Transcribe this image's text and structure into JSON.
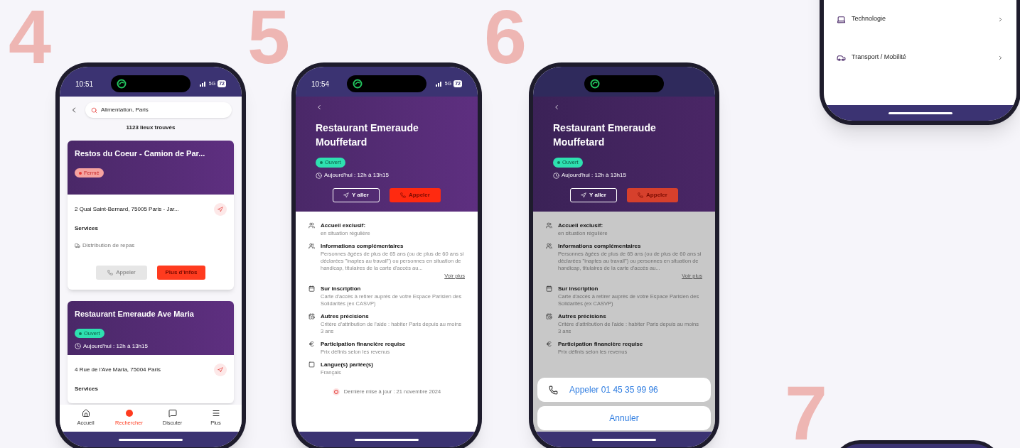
{
  "step_numbers": [
    "4",
    "5",
    "6",
    "7"
  ],
  "screens": [
    {
      "kind": "search_results",
      "status_bar": {
        "time": "10:51",
        "network": "5G",
        "battery": "72"
      },
      "search": {
        "value": "Alimentation, Paris"
      },
      "result_count": "1123 lieux trouvés",
      "cards": [
        {
          "title": "Restos du Coeur - Camion de Par...",
          "badge": {
            "label": "Fermé",
            "open": false
          },
          "address": "2 Quai Saint-Bernard, 75005 Paris - Jar...",
          "services_label": "Services",
          "services": [
            "Distribution de repas"
          ],
          "buttons": [
            "Appeler",
            "Plus d'infos"
          ]
        },
        {
          "title": "Restaurant Emeraude Ave Maria",
          "badge": {
            "label": "Ouvert",
            "open": true
          },
          "hours": "Aujourd'hui : 12h à 13h15",
          "address": "4 Rue de l'Ave Maria, 75004 Paris",
          "services_label": "Services"
        }
      ],
      "tab_bar": [
        {
          "label": "Accueil",
          "selected": false
        },
        {
          "label": "Rechercher",
          "selected": true
        },
        {
          "label": "Discuter",
          "selected": false
        },
        {
          "label": "Plus",
          "selected": false
        }
      ]
    },
    {
      "kind": "place_detail",
      "dimmed": false,
      "status_bar": {
        "time": "10:54",
        "network": "5G",
        "battery": "72"
      },
      "title": "Restaurant Emeraude Mouffetard",
      "badge": {
        "label": "Ouvert",
        "open": true
      },
      "hours": "Aujourd'hui : 12h à 13h15",
      "actions": [
        "Y aller",
        "Appeler"
      ],
      "info": [
        {
          "title": "Accueil exclusif:",
          "text": "en situation régulière"
        },
        {
          "title": "Informations complémentaires",
          "text": "Personnes âgées de plus de 65 ans (ou de plus de 60 ans si déclarées \"inaptes au travail\") ou personnes en situation de handicap, titulaires de la carte d'accès au...",
          "link": "Voir plus"
        },
        {
          "title": "Sur inscription",
          "text": "Carte d'accès à retirer auprès de votre Espace Parisien des Solidarités (ex CASVP)"
        },
        {
          "title": "Autres précisions",
          "text": "Critère d'attribution de l'aide : habiter Paris depuis au moins 3 ans"
        },
        {
          "title": "Participation financière requise",
          "text": "Prix définis selon les revenus"
        },
        {
          "title": "Langue(s) parlée(s)",
          "text": "Français"
        }
      ],
      "last_update": "Dernière mise à jour : 21 novembre 2024"
    },
    {
      "kind": "place_detail",
      "dimmed": true,
      "title": "Restaurant Emeraude Mouffetard",
      "badge": {
        "label": "Ouvert",
        "open": true
      },
      "hours": "Aujourd'hui : 12h à 13h15",
      "actions": [
        "Y aller",
        "Appeler"
      ],
      "info": [
        {
          "title": "Accueil exclusif:",
          "text": "en situation régulière"
        },
        {
          "title": "Informations complémentaires",
          "text": "Personnes âgées de plus de 65 ans (ou de plus de 60 ans si déclarées \"inaptes au travail\") ou personnes en situation de handicap, titulaires de la carte d'accès au...",
          "link": "Voir plus"
        },
        {
          "title": "Sur inscription",
          "text": "Carte d'accès à retirer auprès de votre Espace Parisien des Solidarités (ex CASVP)"
        },
        {
          "title": "Autres précisions",
          "text": "Critère d'attribution de l'aide : habiter Paris depuis au moins 3 ans"
        },
        {
          "title": "Participation financière requise",
          "text": "Prix définis selon les revenus"
        }
      ],
      "action_sheet": {
        "call": "Appeler 01 45 35 99 96",
        "cancel": "Annuler"
      }
    },
    {
      "kind": "category_menu",
      "items": [
        {
          "label": "Technologie"
        },
        {
          "label": "Transport / Mobilité"
        }
      ]
    }
  ]
}
